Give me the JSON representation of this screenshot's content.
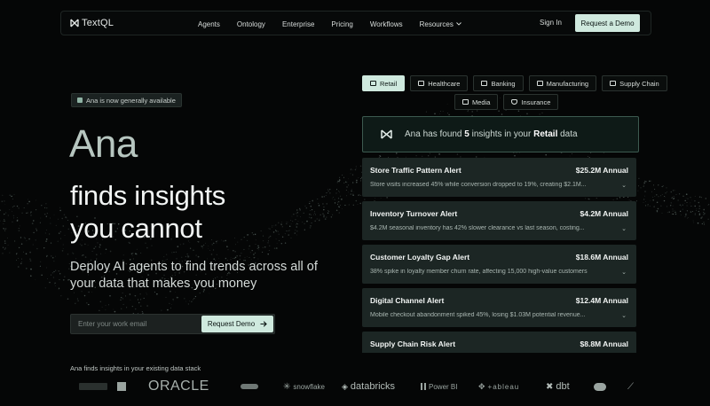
{
  "nav": {
    "brand": "TextQL",
    "links": [
      "Agents",
      "Ontology",
      "Enterprise",
      "Pricing",
      "Workflows"
    ],
    "resources_label": "Resources",
    "signin_label": "Sign In",
    "demo_label": "Request a Demo"
  },
  "hero": {
    "badge": "Ana is now generally available",
    "title": "Ana",
    "line1": "finds insights",
    "line2": "you cannot",
    "subtitle": "Deploy AI agents to find trends across all of your data that makes you money",
    "email_placeholder": "Enter your work email",
    "request_label": "Request Demo"
  },
  "industries": {
    "row1": [
      {
        "label": "Retail",
        "active": true,
        "icon": "store-icon"
      },
      {
        "label": "Healthcare",
        "active": false,
        "icon": "healthcare-icon"
      },
      {
        "label": "Banking",
        "active": false,
        "icon": "bank-icon"
      },
      {
        "label": "Manufacturing",
        "active": false,
        "icon": "factory-icon"
      },
      {
        "label": "Supply Chain",
        "active": false,
        "icon": "truck-icon"
      }
    ],
    "row2": [
      {
        "label": "Media",
        "active": false,
        "icon": "film-icon"
      },
      {
        "label": "Insurance",
        "active": false,
        "icon": "shield-icon"
      }
    ]
  },
  "found": {
    "prefix": "Ana has found",
    "count": "5",
    "middle": "insights in your",
    "industry": "Retail",
    "suffix": "data"
  },
  "alerts": [
    {
      "title": "Store Traffic Pattern Alert",
      "value": "$25.2M Annual",
      "desc": "Store visits increased 45% while conversion dropped to 19%, creating $2.1M..."
    },
    {
      "title": "Inventory Turnover Alert",
      "value": "$4.2M Annual",
      "desc": "$4.2M seasonal inventory has 42% slower clearance vs last season, costing..."
    },
    {
      "title": "Customer Loyalty Gap Alert",
      "value": "$18.6M Annual",
      "desc": "38% spike in loyalty member churn rate, affecting 15,000 high-value customers"
    },
    {
      "title": "Digital Channel Alert",
      "value": "$12.4M Annual",
      "desc": "Mobile checkout abandonment spiked 45%, losing $1.03M potential revenue..."
    },
    {
      "title": "Supply Chain Risk Alert",
      "value": "$8.8M Annual",
      "desc": ""
    }
  ],
  "stack": {
    "heading": "Ana finds insights in your existing data stack",
    "logos": [
      "ORACLE",
      "snowflake",
      "databricks",
      "Power BI",
      "+ableau",
      "dbt"
    ]
  }
}
